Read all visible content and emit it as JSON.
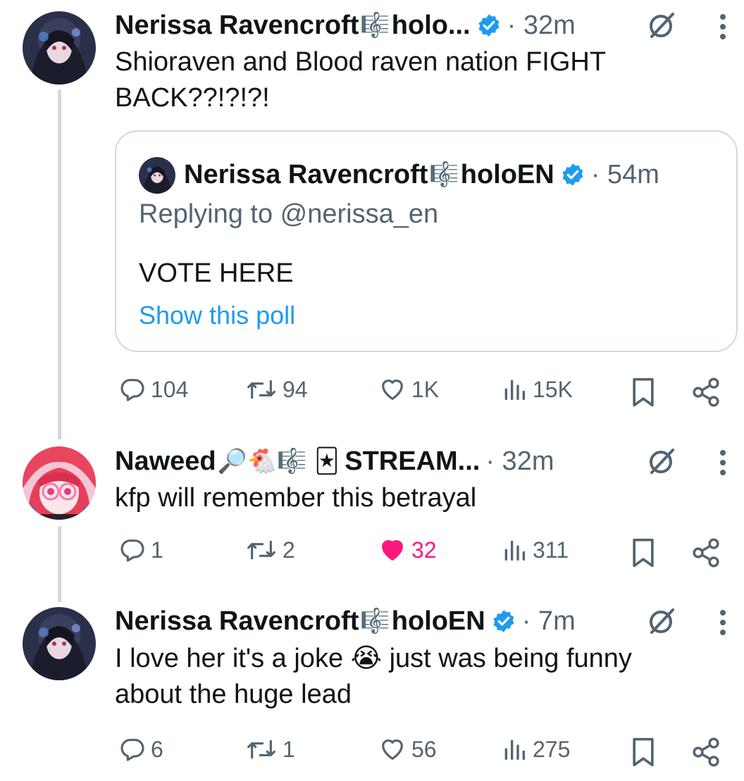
{
  "posts": [
    {
      "author": "Nerissa Ravencroft",
      "glyph": "🎼",
      "handle_tail": "holo...",
      "time": "· 32m",
      "text": "Shioraven and Blood raven nation FIGHT\nBACK??!?!?!",
      "quote": {
        "author": "Nerissa Ravencroft",
        "glyph": "🎼",
        "handle_tail": "holoEN",
        "time": "· 54m",
        "replying": "Replying to @nerissa_en",
        "text": "VOTE HERE",
        "poll_link": "Show this poll"
      },
      "actions": {
        "replies": "104",
        "reposts": "94",
        "likes": "1K",
        "views": "15K"
      }
    },
    {
      "author": "Naweed",
      "glyph": "🔎🐔🎼 🃏",
      "handle_tail": "STREAM...",
      "time": "· 32m",
      "text": "kfp will remember this betrayal",
      "actions": {
        "replies": "1",
        "reposts": "2",
        "likes": "32",
        "views": "311"
      }
    },
    {
      "author": "Nerissa Ravencroft",
      "glyph": "🎼",
      "handle_tail": "holoEN",
      "time": "· 7m",
      "text": "I love her it's a joke 😭 just was being funny\nabout the huge lead",
      "actions": {
        "replies": "6",
        "reposts": "1",
        "likes": "56",
        "views": "275"
      }
    }
  ],
  "colors": {
    "text": "#0f1419",
    "secondary": "#536471",
    "link": "#1d9bf0",
    "verified": "#1d9bf0",
    "like_active": "#f91880",
    "border": "#cfd9de"
  },
  "icons": [
    "reply-icon",
    "repost-icon",
    "like-icon",
    "views-icon",
    "bookmark-icon",
    "share-icon",
    "grok-icon",
    "more-icon",
    "verified-badge-icon"
  ]
}
